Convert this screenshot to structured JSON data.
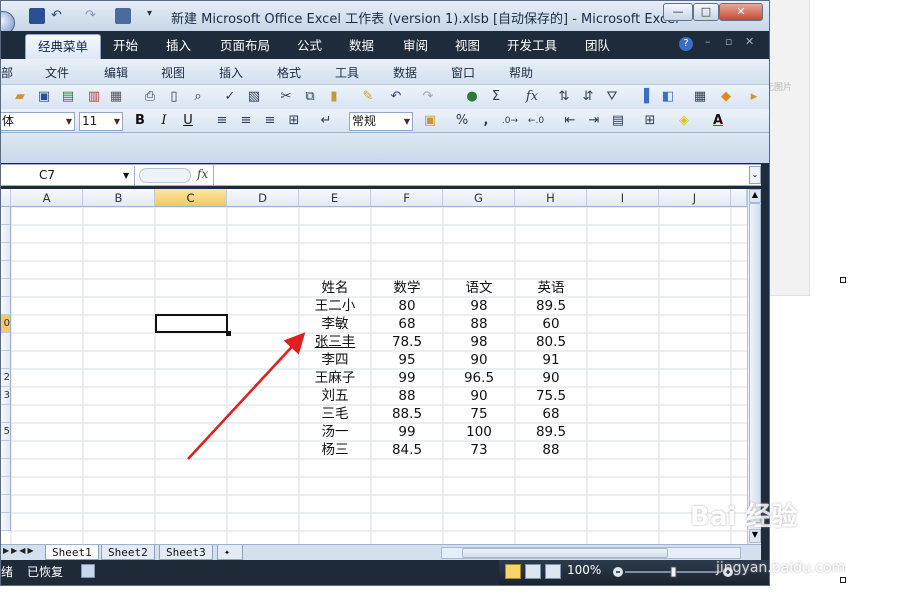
{
  "window": {
    "title": "新建 Microsoft Office Excel 工作表 (version 1).xlsb [自动保存的] - Microsoft Excel"
  },
  "ribbon_tabs": [
    "经典菜单",
    "开始",
    "插入",
    "页面布局",
    "公式",
    "数据",
    "审阅",
    "视图",
    "开发工具",
    "团队"
  ],
  "classic_menu": [
    "部",
    "文件",
    "编辑",
    "视图",
    "插入",
    "格式",
    "工具",
    "数据",
    "窗口",
    "帮助"
  ],
  "format_bar": {
    "font_name": "体",
    "font_size": "11",
    "number_format": "常规",
    "bold": "B",
    "italic": "I",
    "underline": "U",
    "percent": "%",
    "comma": ","
  },
  "formula_bar": {
    "name_box": "C7",
    "fx": "fx",
    "formula": ""
  },
  "columns": [
    "A",
    "B",
    "C",
    "D",
    "E",
    "F",
    "G",
    "H",
    "I",
    "J"
  ],
  "active_column": "C",
  "table": {
    "headers": [
      "姓名",
      "数学",
      "语文",
      "英语"
    ],
    "rows": [
      [
        "王二小",
        "80",
        "98",
        "89.5"
      ],
      [
        "李敏",
        "68",
        "88",
        "60"
      ],
      [
        "张三丰",
        "78.5",
        "98",
        "80.5"
      ],
      [
        "李四",
        "95",
        "90",
        "91"
      ],
      [
        "王麻子",
        "99",
        "96.5",
        "90"
      ],
      [
        "刘五",
        "88",
        "90",
        "75.5"
      ],
      [
        "三毛",
        "88.5",
        "75",
        "68"
      ],
      [
        "汤一",
        "99",
        "100",
        "89.5"
      ],
      [
        "杨三",
        "84.5",
        "73",
        "88"
      ]
    ]
  },
  "row_labels": [
    "",
    "",
    "",
    "",
    "",
    "",
    "0",
    "",
    "",
    "2",
    "3",
    "",
    "5",
    "",
    "",
    "",
    "",
    ""
  ],
  "sheet_tabs": [
    "Sheet1",
    "Sheet2",
    "Sheet3"
  ],
  "active_sheet": "Sheet1",
  "status": {
    "ready": "绪",
    "recovered": "已恢复",
    "zoom": "100%"
  },
  "annotation": {
    "arrow_color": "#e02020"
  },
  "right_page_text": "无图片",
  "watermark": {
    "brand": "Bai 经验",
    "url": "jingyan.baidu.com"
  }
}
